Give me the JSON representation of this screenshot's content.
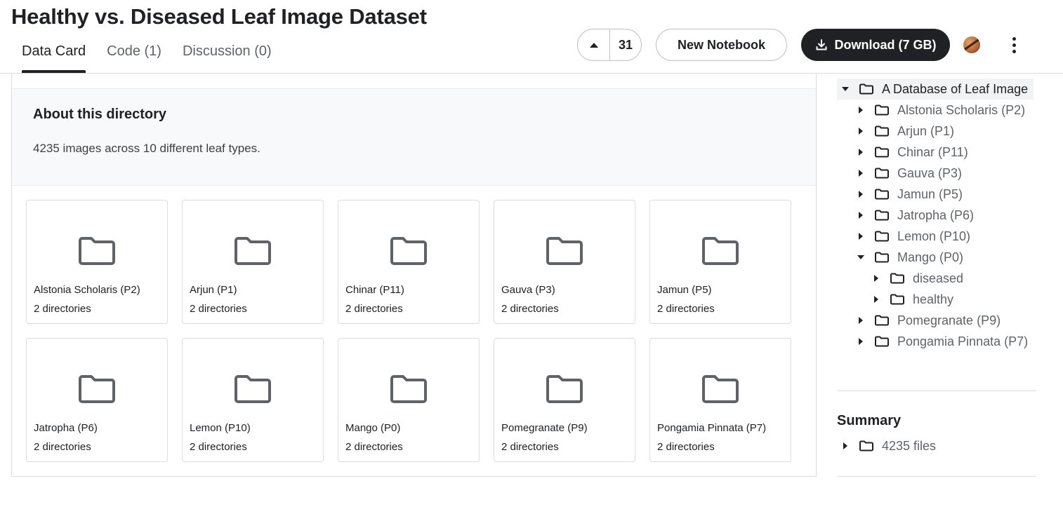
{
  "header": {
    "title": "Healthy vs. Diseased Leaf Image Dataset",
    "tabs": [
      {
        "label": "Data Card"
      },
      {
        "label": "Code (1)"
      },
      {
        "label": "Discussion (0)"
      }
    ],
    "upvote_count": "31",
    "new_notebook_label": "New Notebook",
    "download_label": "Download (7 GB)"
  },
  "about": {
    "title": "About this directory",
    "description": "4235 images across 10 different leaf types."
  },
  "folders": [
    {
      "name": "Alstonia Scholaris (P2)",
      "sub": "2 directories"
    },
    {
      "name": "Arjun (P1)",
      "sub": "2 directories"
    },
    {
      "name": "Chinar (P11)",
      "sub": "2 directories"
    },
    {
      "name": "Gauva (P3)",
      "sub": "2 directories"
    },
    {
      "name": "Jamun (P5)",
      "sub": "2 directories"
    },
    {
      "name": "Jatropha (P6)",
      "sub": "2 directories"
    },
    {
      "name": "Lemon (P10)",
      "sub": "2 directories"
    },
    {
      "name": "Mango (P0)",
      "sub": "2 directories"
    },
    {
      "name": "Pomegranate (P9)",
      "sub": "2 directories"
    },
    {
      "name": "Pongamia Pinnata (P7)",
      "sub": "2 directories"
    }
  ],
  "tree": {
    "root": "A Database of Leaf Image",
    "items": [
      {
        "label": "Alstonia Scholaris (P2)"
      },
      {
        "label": "Arjun (P1)"
      },
      {
        "label": "Chinar (P11)"
      },
      {
        "label": "Gauva (P3)"
      },
      {
        "label": "Jamun (P5)"
      },
      {
        "label": "Jatropha (P6)"
      },
      {
        "label": "Lemon (P10)"
      },
      {
        "label": "Mango (P0)"
      },
      {
        "label": "diseased"
      },
      {
        "label": "healthy"
      },
      {
        "label": "Pomegranate (P9)"
      },
      {
        "label": "Pongamia Pinnata (P7)"
      }
    ]
  },
  "summary": {
    "title": "Summary",
    "files_label": "4235 files"
  },
  "colors": {
    "text_primary": "#202124",
    "text_secondary": "#5f6368",
    "folder_icon": "#5f6368",
    "download_bg": "#202124",
    "border": "#dadce0",
    "about_bg": "#f8f9fa"
  },
  "icons": {
    "upvote": "triangle-up-icon",
    "download": "download-icon",
    "folder": "folder-icon",
    "caret_right": "caret-right-icon",
    "caret_down": "caret-down-icon",
    "more": "more-vert-icon",
    "avatar": "user-avatar"
  }
}
